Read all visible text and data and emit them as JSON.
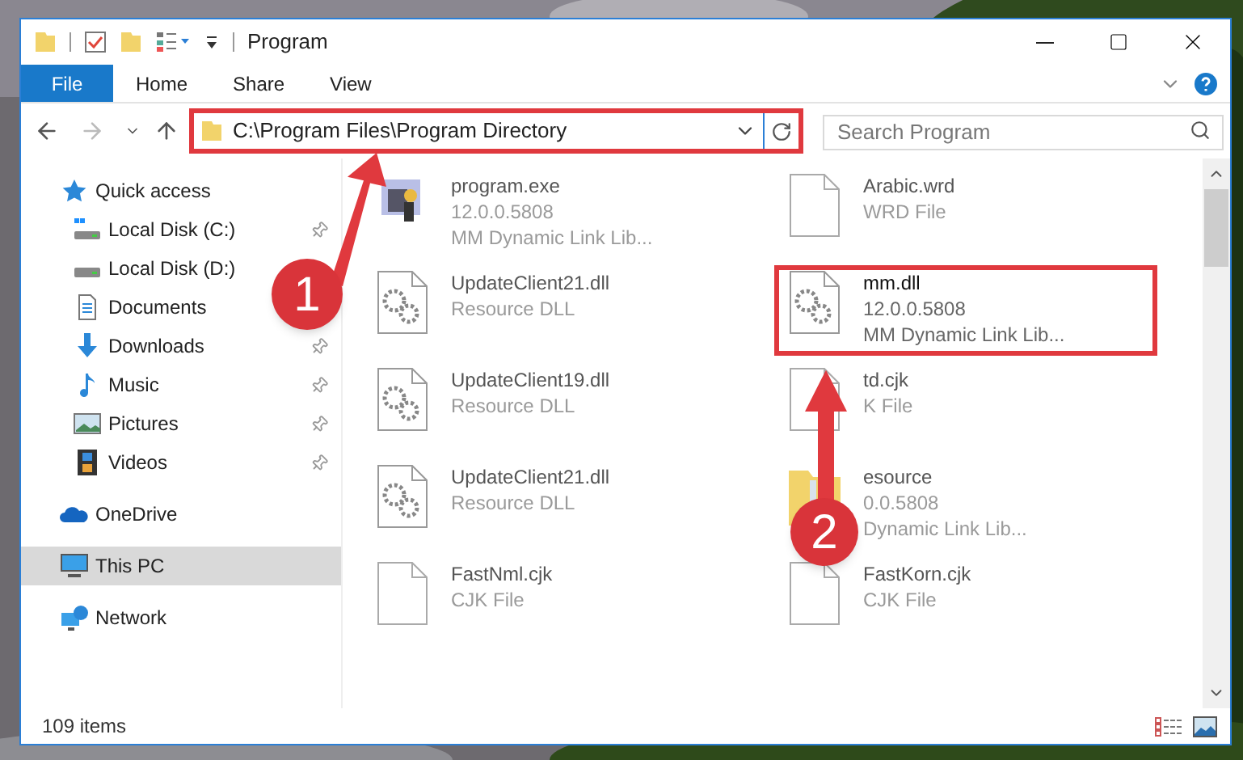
{
  "window": {
    "title": "Program"
  },
  "ribbon": {
    "tabs": [
      {
        "label": "File",
        "selected": true
      },
      {
        "label": "Home",
        "selected": false
      },
      {
        "label": "Share",
        "selected": false
      },
      {
        "label": "View",
        "selected": false
      }
    ]
  },
  "address": {
    "path": "C:\\Program Files\\Program Directory",
    "highlighted": true
  },
  "search": {
    "placeholder": "Search Program"
  },
  "sidebar": {
    "items": [
      {
        "label": "Quick access",
        "pinned": false,
        "selected": false,
        "group": true
      },
      {
        "label": "Local Disk (C:)",
        "pinned": true,
        "selected": false,
        "group": false
      },
      {
        "label": "Local Disk (D:)",
        "pinned": false,
        "selected": false,
        "group": false
      },
      {
        "label": "Documents",
        "pinned": false,
        "selected": false,
        "group": false
      },
      {
        "label": "Downloads",
        "pinned": true,
        "selected": false,
        "group": false
      },
      {
        "label": "Music",
        "pinned": true,
        "selected": false,
        "group": false
      },
      {
        "label": "Pictures",
        "pinned": true,
        "selected": false,
        "group": false
      },
      {
        "label": "Videos",
        "pinned": true,
        "selected": false,
        "group": false
      },
      {
        "label": "OneDrive",
        "pinned": false,
        "selected": false,
        "group": true
      },
      {
        "label": "This PC",
        "pinned": false,
        "selected": true,
        "group": true
      },
      {
        "label": "Network",
        "pinned": false,
        "selected": false,
        "group": true
      }
    ]
  },
  "files": [
    {
      "kind": "exe",
      "lines": [
        "program.exe",
        "12.0.0.5808",
        "MM Dynamic Link Lib..."
      ],
      "highlighted": false
    },
    {
      "kind": "blank",
      "lines": [
        "Arabic.wrd",
        "WRD File"
      ],
      "highlighted": false
    },
    {
      "kind": "dll",
      "lines": [
        "UpdateClient21.dll",
        "Resource DLL"
      ],
      "highlighted": false
    },
    {
      "kind": "dll",
      "lines": [
        "mm.dll",
        "12.0.0.5808",
        "MM Dynamic Link Lib..."
      ],
      "highlighted": true
    },
    {
      "kind": "dll",
      "lines": [
        "UpdateClient19.dll",
        "Resource DLL"
      ],
      "highlighted": false
    },
    {
      "kind": "blank",
      "lines": [
        "td.cjk",
        "K File"
      ],
      "highlighted": false
    },
    {
      "kind": "dll",
      "lines": [
        "UpdateClient21.dll",
        "Resource DLL"
      ],
      "highlighted": false
    },
    {
      "kind": "folder",
      "lines": [
        "esource",
        "0.0.5808",
        "Dynamic Link Lib..."
      ],
      "highlighted": false
    },
    {
      "kind": "blank",
      "lines": [
        "FastNml.cjk",
        "CJK File"
      ],
      "highlighted": false
    },
    {
      "kind": "blank",
      "lines": [
        "FastKorn.cjk",
        "CJK File"
      ],
      "highlighted": false
    }
  ],
  "status_bar": {
    "count": "109 items"
  },
  "annotations": [
    {
      "label": "1"
    },
    {
      "label": "2"
    }
  ]
}
